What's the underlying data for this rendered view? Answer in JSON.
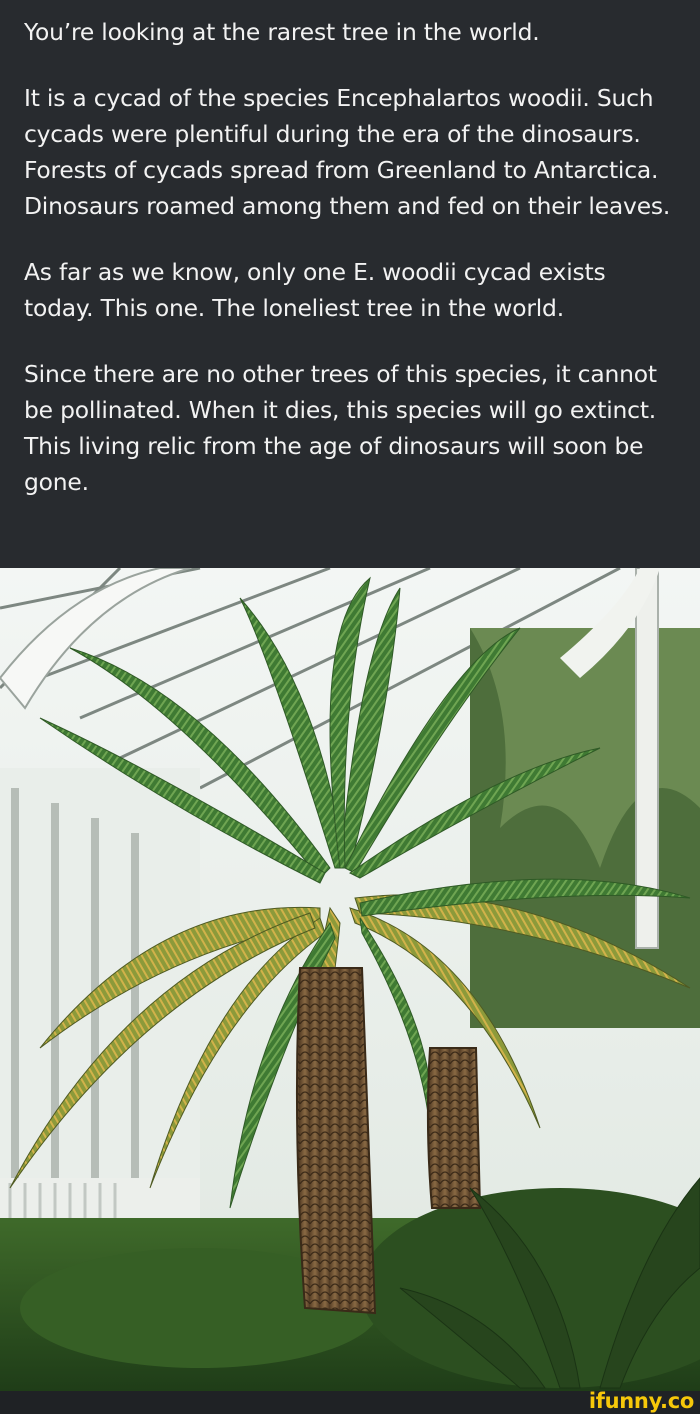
{
  "post": {
    "paragraphs": [
      "You’re looking at the rarest tree in the world.",
      "It is a cycad of the species Encephalartos woodii. Such cycads were plentiful during the era of the dinosaurs. Forests of cycads spread from Greenland to Antarctica. Dinosaurs roamed among them and fed on their leaves.",
      "As far as we know, only one E. woodii cycad exists today. This one. The loneliest tree in the world.",
      "Since there are no other trees of this species, it cannot be pollinated. When it dies, this species will go extinct. This living relic from the age of dinosaurs will soon be gone."
    ]
  },
  "watermark": {
    "text": "ifunny.co",
    "color": "#f6c80a"
  },
  "colors": {
    "text_background": "#282b2f",
    "text_color": "#f2f2f2"
  }
}
